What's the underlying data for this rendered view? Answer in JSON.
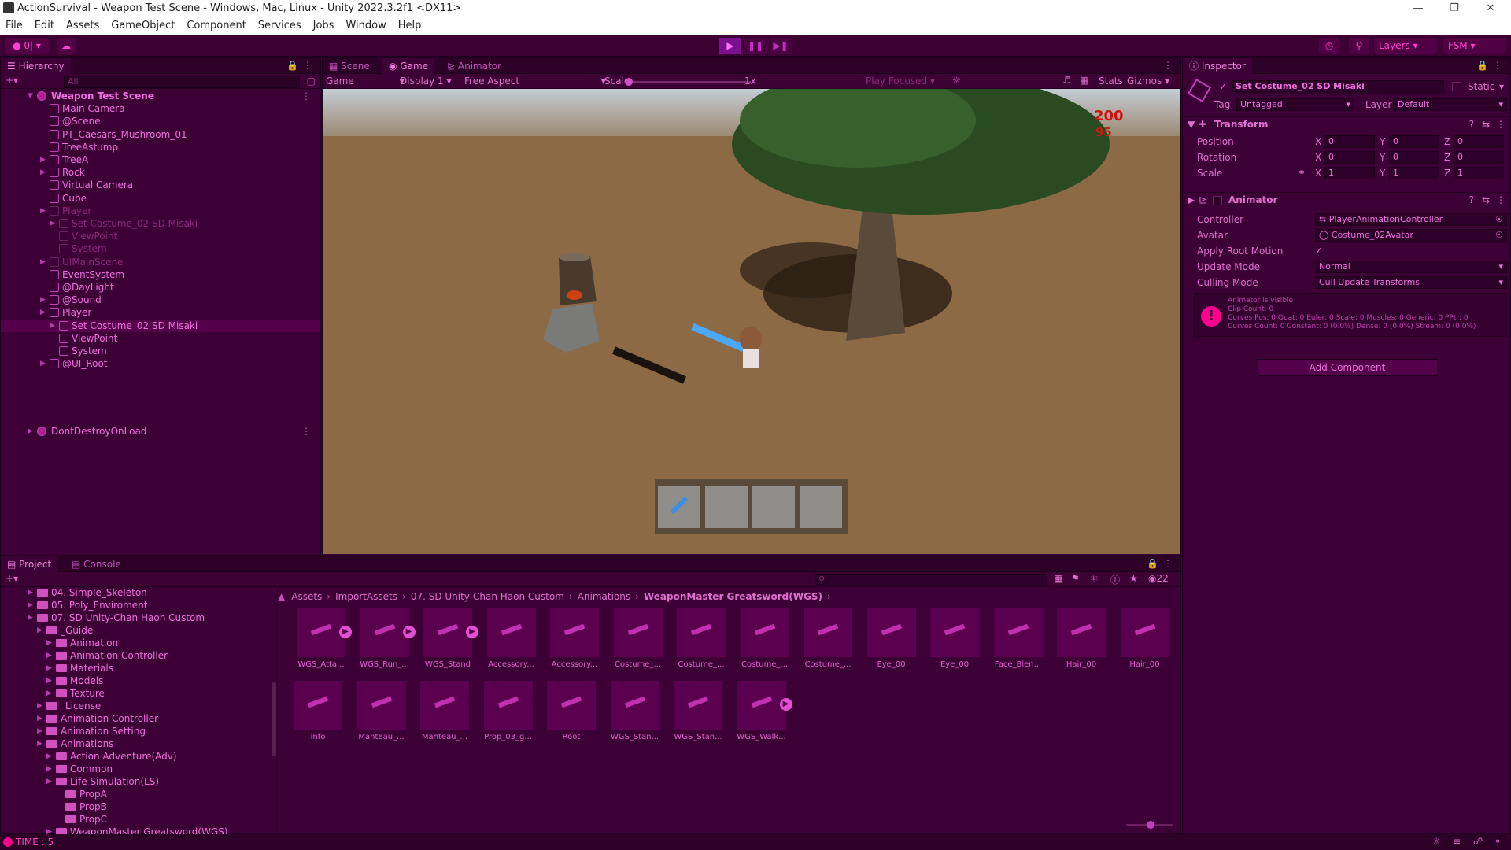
{
  "window": {
    "title": "ActionSurvival - Weapon Test Scene - Windows, Mac, Linux - Unity 2022.3.2f1 <DX11>"
  },
  "menu": [
    "File",
    "Edit",
    "Assets",
    "GameObject",
    "Component",
    "Services",
    "Jobs",
    "Window",
    "Help"
  ],
  "toolbar": {
    "account": "0|",
    "layers": "Layers",
    "layout": "FSM"
  },
  "hierarchy": {
    "tab": "Hierarchy",
    "search_placeholder": "All",
    "scene": "Weapon Test Scene",
    "items": [
      {
        "label": "Main Camera",
        "depth": 1,
        "dim": false,
        "arrow": false
      },
      {
        "label": "@Scene",
        "depth": 1,
        "dim": false,
        "arrow": false
      },
      {
        "label": "PT_Caesars_Mushroom_01",
        "depth": 1,
        "dim": false,
        "arrow": false
      },
      {
        "label": "TreeAstump",
        "depth": 1,
        "dim": false,
        "arrow": false
      },
      {
        "label": "TreeA",
        "depth": 1,
        "dim": false,
        "arrow": true
      },
      {
        "label": "Rock",
        "depth": 1,
        "dim": false,
        "arrow": true
      },
      {
        "label": "Virtual Camera",
        "depth": 1,
        "dim": false,
        "arrow": false
      },
      {
        "label": "Cube",
        "depth": 1,
        "dim": false,
        "arrow": false
      },
      {
        "label": "Player",
        "depth": 1,
        "dim": true,
        "arrow": true
      },
      {
        "label": "Set Costume_02 SD Misaki",
        "depth": 2,
        "dim": true,
        "arrow": true
      },
      {
        "label": "ViewPoint",
        "depth": 2,
        "dim": true,
        "arrow": false
      },
      {
        "label": "System",
        "depth": 2,
        "dim": true,
        "arrow": false
      },
      {
        "label": "UIMainScene",
        "depth": 1,
        "dim": true,
        "arrow": true
      },
      {
        "label": "EventSystem",
        "depth": 1,
        "dim": false,
        "arrow": false
      },
      {
        "label": "@DayLight",
        "depth": 1,
        "dim": false,
        "arrow": false
      },
      {
        "label": "@Sound",
        "depth": 1,
        "dim": false,
        "arrow": true
      },
      {
        "label": "Player",
        "depth": 1,
        "dim": false,
        "arrow": true
      },
      {
        "label": "Set Costume_02 SD Misaki",
        "depth": 2,
        "dim": false,
        "arrow": true,
        "selected": true
      },
      {
        "label": "ViewPoint",
        "depth": 2,
        "dim": false,
        "arrow": false
      },
      {
        "label": "System",
        "depth": 2,
        "dim": false,
        "arrow": false
      },
      {
        "label": "@UI_Root",
        "depth": 1,
        "dim": false,
        "arrow": true
      }
    ],
    "ddol": "DontDestroyOnLoad"
  },
  "center": {
    "tabs": [
      "Scene",
      "Game",
      "Animator"
    ],
    "active_tab": "Game",
    "game_bar": {
      "mode": "Game",
      "display": "Display 1",
      "aspect": "Free Aspect",
      "scale_label": "Scale",
      "scale_value": "1x",
      "play_focused": "Play Focused",
      "stats": "Stats",
      "gizmos": "Gizmos"
    },
    "hud": {
      "hp": "200",
      "sub": "95"
    }
  },
  "inspector": {
    "tab": "Inspector",
    "object_name": "Set Costume_02 SD Misaki",
    "static_label": "Static",
    "tag_label": "Tag",
    "tag_value": "Untagged",
    "layer_label": "Layer",
    "layer_value": "Default",
    "transform": {
      "title": "Transform",
      "rows": [
        {
          "label": "Position",
          "x": "0",
          "y": "0",
          "z": "0"
        },
        {
          "label": "Rotation",
          "x": "0",
          "y": "0",
          "z": "0"
        },
        {
          "label": "Scale",
          "x": "1",
          "y": "1",
          "z": "1"
        }
      ]
    },
    "animator": {
      "title": "Animator",
      "controller_label": "Controller",
      "controller_value": "PlayerAnimationController",
      "avatar_label": "Avatar",
      "avatar_value": "Costume_02Avatar",
      "root_motion_label": "Apply Root Motion",
      "update_label": "Update Mode",
      "update_value": "Normal",
      "culling_label": "Culling Mode",
      "culling_value": "Cull Update Transforms",
      "info_lines": [
        "Animator is visible",
        "Clip Count: 0",
        "Curves Pos: 0 Quat: 0 Euler: 0 Scale: 0 Muscles: 0 Generic: 0 PPtr: 0",
        "Curves Count: 0 Constant: 0 (0.0%) Dense: 0 (0.0%) Stream: 0 (0.0%)"
      ]
    },
    "add_component": "Add Component"
  },
  "project": {
    "tabs": [
      "Project",
      "Console"
    ],
    "hidden_count": "22",
    "tree": [
      {
        "label": "04. Simple_Skeleton",
        "depth": 1
      },
      {
        "label": "05. Poly_Enviroment",
        "depth": 1
      },
      {
        "label": "07. SD Unity-Chan Haon Custom",
        "depth": 1
      },
      {
        "label": "_Guide",
        "depth": 2
      },
      {
        "label": "Animation",
        "depth": 3
      },
      {
        "label": "Animation Controller",
        "depth": 3
      },
      {
        "label": "Materials",
        "depth": 3
      },
      {
        "label": "Models",
        "depth": 3
      },
      {
        "label": "Texture",
        "depth": 3
      },
      {
        "label": "_License",
        "depth": 2
      },
      {
        "label": "Animation Controller",
        "depth": 2
      },
      {
        "label": "Animation Setting",
        "depth": 2
      },
      {
        "label": "Animations",
        "depth": 2
      },
      {
        "label": "Action Adventure(Adv)",
        "depth": 3
      },
      {
        "label": "Common",
        "depth": 3
      },
      {
        "label": "Life Simulation(LS)",
        "depth": 3
      },
      {
        "label": "PropA",
        "depth": 4
      },
      {
        "label": "PropB",
        "depth": 4
      },
      {
        "label": "PropC",
        "depth": 4
      },
      {
        "label": "WeaponMaster Greatsword(WGS)",
        "depth": 3
      }
    ],
    "breadcrumb": [
      "Assets",
      "ImportAssets",
      "07. SD Unity-Chan Haon Custom",
      "Animations",
      "WeaponMaster Greatsword(WGS)"
    ],
    "assets_row1": [
      "WGS_Atta...",
      "WGS_Run_...",
      "WGS_Stand",
      "Accessory...",
      "Accessory...",
      "Costume_...",
      "Costume_...",
      "Costume_...",
      "Costume_...",
      "Eye_00",
      "Eye_00",
      "Face_Blen...",
      "Hair_00",
      "Hair_00"
    ],
    "assets_row2": [
      "info",
      "Manteau_...",
      "Manteau_...",
      "Prop_03_g...",
      "Root",
      "WGS_Stan...",
      "WGS_Stan...",
      "WGS_Walk..."
    ]
  },
  "status": {
    "text": "TIME : 5"
  },
  "colors": {
    "accent": "#ff40d0",
    "bg": "#3d0036",
    "selected": "#55004a",
    "error": "#ff0090"
  }
}
